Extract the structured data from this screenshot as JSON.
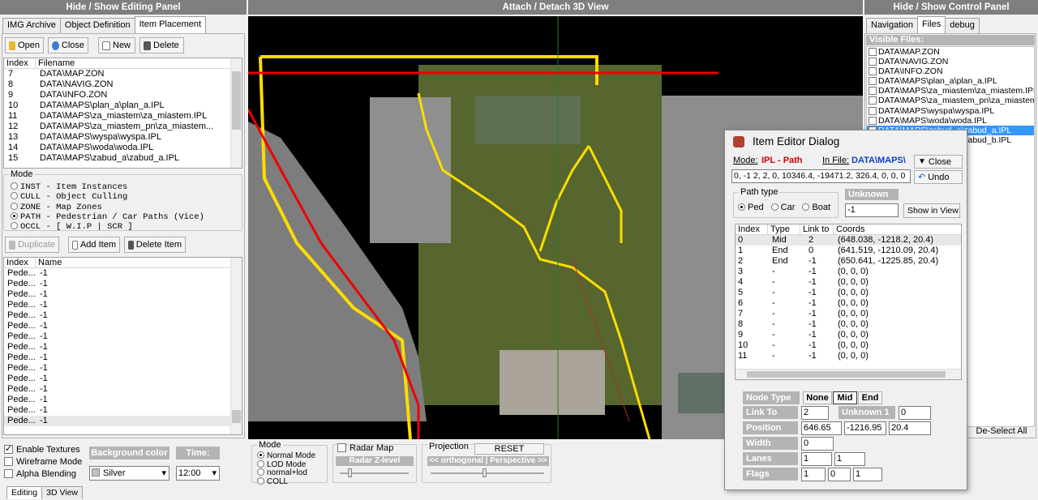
{
  "top_bars": {
    "left": "Hide / Show Editing Panel",
    "center": "Attach / Detach 3D View",
    "right": "Hide / Show Control Panel"
  },
  "left_tabs": [
    "IMG Archive",
    "Object Definition",
    "Item Placement"
  ],
  "toolbar": {
    "open": "Open",
    "close": "Close",
    "new": "New",
    "delete": "Delete"
  },
  "files_list": {
    "headers": [
      "Index",
      "Filename"
    ],
    "rows": [
      [
        "7",
        "DATA\\MAP.ZON"
      ],
      [
        "8",
        "DATA\\NAVIG.ZON"
      ],
      [
        "9",
        "DATA\\INFO.ZON"
      ],
      [
        "10",
        "DATA\\MAPS\\plan_a\\plan_a.IPL"
      ],
      [
        "11",
        "DATA\\MAPS\\za_miastem\\za_miastem.IPL"
      ],
      [
        "12",
        "DATA\\MAPS\\za_miastem_pn\\za_miastem..."
      ],
      [
        "13",
        "DATA\\MAPS\\wyspa\\wyspa.IPL"
      ],
      [
        "14",
        "DATA\\MAPS\\woda\\woda.IPL"
      ],
      [
        "15",
        "DATA\\MAPS\\zabud_a\\zabud_a.IPL"
      ]
    ]
  },
  "mode": {
    "label": "Mode",
    "options": [
      "INST - Item Instances",
      "CULL - Object Culling",
      "ZONE - Map Zones",
      "PATH - Pedestrian / Car Paths (Vice)",
      "OCCL - [ W.I.P | SCR ]"
    ],
    "selected": 3
  },
  "item_buttons": {
    "duplicate": "Duplicate",
    "add": "Add Item",
    "delete": "Delete Item"
  },
  "items_list": {
    "headers": [
      "Index",
      "Name"
    ],
    "rows": [
      [
        "Pede...",
        "-1"
      ],
      [
        "Pede...",
        "-1"
      ],
      [
        "Pede...",
        "-1"
      ],
      [
        "Pede...",
        "-1"
      ],
      [
        "Pede...",
        "-1"
      ],
      [
        "Pede...",
        "-1"
      ],
      [
        "Pede...",
        "-1"
      ],
      [
        "Pede...",
        "-1"
      ],
      [
        "Pede...",
        "-1"
      ],
      [
        "Pede...",
        "-1"
      ],
      [
        "Pede...",
        "-1"
      ],
      [
        "Pede...",
        "-1"
      ],
      [
        "Pede...",
        "-1"
      ],
      [
        "Pede...",
        "-1"
      ],
      [
        "Pede...",
        "-1"
      ]
    ]
  },
  "bottom": {
    "enable_textures": "Enable Textures",
    "wireframe": "Wireframe Mode",
    "alpha": "Alpha Blending",
    "bg_color_label": "Background color",
    "bg_color_value": "Silver",
    "time_label": "Time:",
    "time_value": "12:00",
    "render_mode_label": "Mode",
    "render_modes": [
      "Normal Mode",
      "LOD Mode",
      "normal+lod",
      "COLL"
    ],
    "radar_map": "Radar Map",
    "radar_z": "Radar Z-level",
    "projection_label": "Projection",
    "reset": "RESET",
    "proj_toggle": "<< orthogonal | Perspective >>"
  },
  "bottom_tabs": [
    "Editing",
    "3D View"
  ],
  "right_tabs": [
    "Navigation",
    "Files",
    "debug"
  ],
  "visible_files": {
    "title": "Visible Files:",
    "items": [
      "DATA\\MAP.ZON",
      "DATA\\NAVIG.ZON",
      "DATA\\INFO.ZON",
      "DATA\\MAPS\\plan_a\\plan_a.IPL",
      "DATA\\MAPS\\za_miastem\\za_miastem.IPL",
      "DATA\\MAPS\\za_miastem_pn\\za_miastem_p",
      "DATA\\MAPS\\wyspa\\wyspa.IPL",
      "DATA\\MAPS\\woda\\woda.IPL",
      "DATA\\MAPS\\zabud_a\\zabud_a.IPL",
      "DATA\\MAPS\\zabud_b\\zabud_b.IPL"
    ],
    "selected": 8,
    "deselect": "De-Select All"
  },
  "dialog": {
    "title": "Item Editor Dialog",
    "mode_label": "Mode:",
    "mode_value": "IPL - Path",
    "infile_label": "In File:",
    "infile_value": "DATA\\MAPS\\",
    "close": "Close",
    "undo": "Undo",
    "raw_line": "0, -1          2, 2, 0, 10346.4, -19471.2, 326.4, 0, 0, 0",
    "path_type": "Path type",
    "path_options": [
      "Ped",
      "Car",
      "Boat"
    ],
    "unknown_label": "Unknown",
    "unknown_value": "-1",
    "show_in_view": "Show in View",
    "nodes_headers": [
      "Index",
      "Type",
      "Link to",
      "Coords"
    ],
    "nodes": [
      [
        "0",
        "Mid",
        "2",
        "(648.038, -1218.2, 20.4)"
      ],
      [
        "1",
        "End",
        "0",
        "(641.519, -1210.09, 20.4)"
      ],
      [
        "2",
        "End",
        "-1",
        "(650.641, -1225.85, 20.4)"
      ],
      [
        "3",
        "-",
        "-1",
        "(0, 0, 0)"
      ],
      [
        "4",
        "-",
        "-1",
        "(0, 0, 0)"
      ],
      [
        "5",
        "-",
        "-1",
        "(0, 0, 0)"
      ],
      [
        "6",
        "-",
        "-1",
        "(0, 0, 0)"
      ],
      [
        "7",
        "-",
        "-1",
        "(0, 0, 0)"
      ],
      [
        "8",
        "-",
        "-1",
        "(0, 0, 0)"
      ],
      [
        "9",
        "-",
        "-1",
        "(0, 0, 0)"
      ],
      [
        "10",
        "-",
        "-1",
        "(0, 0, 0)"
      ],
      [
        "11",
        "-",
        "-1",
        "(0, 0, 0)"
      ]
    ],
    "node_type_label": "Node Type",
    "node_types": [
      "None",
      "Mid",
      "End"
    ],
    "link_to_label": "Link To",
    "link_to_value": "2",
    "unknown1_label": "Unknown 1",
    "unknown1_value": "0",
    "position_label": "Position",
    "pos_x": "646.65",
    "pos_y": "-1216.95",
    "pos_z": "20.4",
    "width_label": "Width",
    "width_value": "0",
    "lanes_label": "Lanes",
    "lanes_a": "1",
    "lanes_b": "1",
    "flags_label": "Flags",
    "flags_a": "1",
    "flags_b": "0",
    "flags_c": "1"
  }
}
